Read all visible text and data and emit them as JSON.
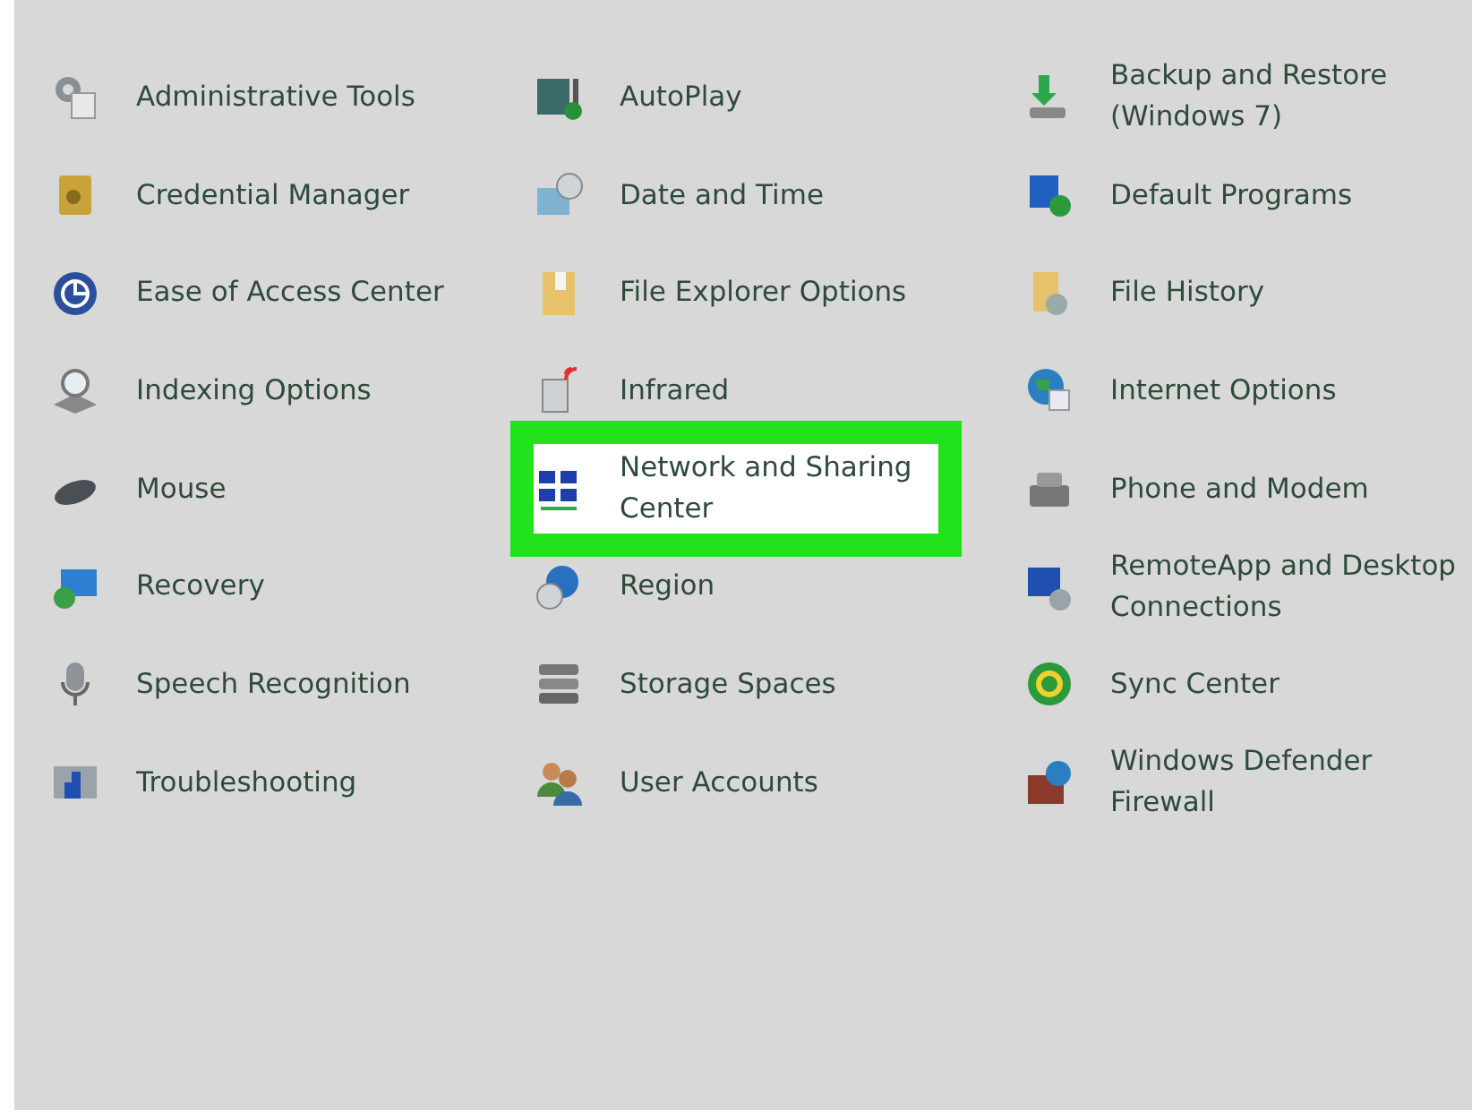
{
  "columns": [
    {
      "items": [
        {
          "label": "Administrative Tools",
          "highlighted": false
        },
        {
          "label": "Credential Manager",
          "highlighted": false
        },
        {
          "label": "Ease of Access Center",
          "highlighted": false
        },
        {
          "label": "Indexing Options",
          "highlighted": false
        },
        {
          "label": "Mouse",
          "highlighted": false
        },
        {
          "label": "Recovery",
          "highlighted": false
        },
        {
          "label": "Speech Recognition",
          "highlighted": false
        },
        {
          "label": "Troubleshooting",
          "highlighted": false
        }
      ]
    },
    {
      "items": [
        {
          "label": "AutoPlay",
          "highlighted": false
        },
        {
          "label": "Date and Time",
          "highlighted": false
        },
        {
          "label": "File Explorer Options",
          "highlighted": false
        },
        {
          "label": "Infrared",
          "highlighted": false
        },
        {
          "label": "Network and Sharing Center",
          "highlighted": true
        },
        {
          "label": "Region",
          "highlighted": false
        },
        {
          "label": "Storage Spaces",
          "highlighted": false
        },
        {
          "label": "User Accounts",
          "highlighted": false
        }
      ]
    },
    {
      "items": [
        {
          "label": "Backup and Restore (Windows 7)",
          "highlighted": false
        },
        {
          "label": "Default Programs",
          "highlighted": false
        },
        {
          "label": "File History",
          "highlighted": false
        },
        {
          "label": "Internet Options",
          "highlighted": false
        },
        {
          "label": "Phone and Modem",
          "highlighted": false
        },
        {
          "label": "RemoteApp and Desktop Connections",
          "highlighted": false
        },
        {
          "label": "Sync Center",
          "highlighted": false
        },
        {
          "label": "Windows Defender Firewall",
          "highlighted": false
        }
      ]
    }
  ]
}
